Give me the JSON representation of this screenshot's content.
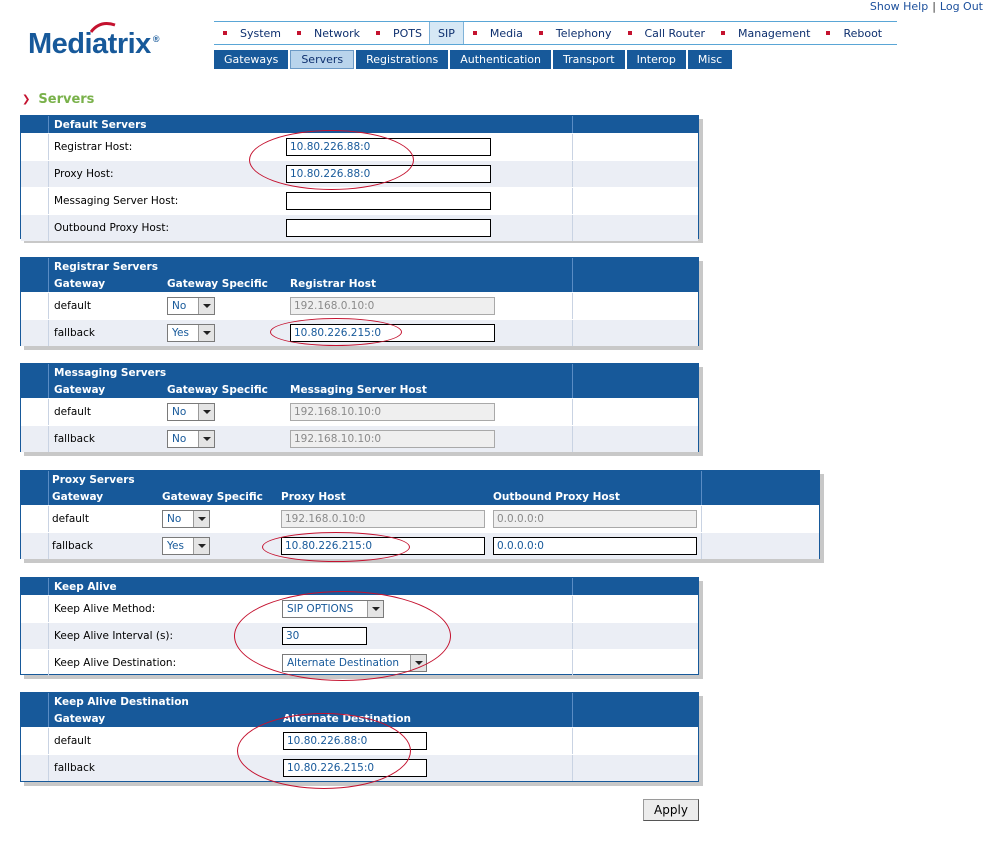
{
  "header": {
    "show_help": "Show Help",
    "separator": "|",
    "log_out": "Log Out",
    "logo": "Mediatrix",
    "logo_reg": "®"
  },
  "main_nav": [
    "System",
    "Network",
    "POTS",
    "SIP",
    "Media",
    "Telephony",
    "Call Router",
    "Management",
    "Reboot"
  ],
  "main_nav_active": "SIP",
  "sub_nav": [
    "Gateways",
    "Servers",
    "Registrations",
    "Authentication",
    "Transport",
    "Interop",
    "Misc"
  ],
  "sub_nav_active": "Servers",
  "page_title": "Servers",
  "default_servers": {
    "title": "Default Servers",
    "rows": [
      {
        "label": "Registrar Host:",
        "value": "10.80.226.88:0"
      },
      {
        "label": "Proxy Host:",
        "value": "10.80.226.88:0"
      },
      {
        "label": "Messaging Server Host:",
        "value": ""
      },
      {
        "label": "Outbound Proxy Host:",
        "value": ""
      }
    ]
  },
  "registrar_servers": {
    "title": "Registrar Servers",
    "col_gateway": "Gateway",
    "col_specific": "Gateway Specific",
    "col_host": "Registrar Host",
    "rows": [
      {
        "gateway": "default",
        "specific": "No",
        "host": "192.168.0.10:0"
      },
      {
        "gateway": "fallback",
        "specific": "Yes",
        "host": "10.80.226.215:0"
      }
    ]
  },
  "messaging_servers": {
    "title": "Messaging Servers",
    "col_gateway": "Gateway",
    "col_specific": "Gateway Specific",
    "col_host": "Messaging Server Host",
    "rows": [
      {
        "gateway": "default",
        "specific": "No",
        "host": "192.168.10.10:0"
      },
      {
        "gateway": "fallback",
        "specific": "No",
        "host": "192.168.10.10:0"
      }
    ]
  },
  "proxy_servers": {
    "title": "Proxy Servers",
    "col_gateway": "Gateway",
    "col_specific": "Gateway Specific",
    "col_host": "Proxy Host",
    "col_outbound": "Outbound Proxy Host",
    "rows": [
      {
        "gateway": "default",
        "specific": "No",
        "host": "192.168.0.10:0",
        "outbound": "0.0.0.0:0"
      },
      {
        "gateway": "fallback",
        "specific": "Yes",
        "host": "10.80.226.215:0",
        "outbound": "0.0.0.0:0"
      }
    ]
  },
  "keep_alive": {
    "title": "Keep Alive",
    "method_label": "Keep Alive Method:",
    "method_value": "SIP OPTIONS",
    "interval_label": "Keep Alive Interval (s):",
    "interval_value": "30",
    "destination_label": "Keep Alive Destination:",
    "destination_value": "Alternate Destination"
  },
  "keep_alive_destination": {
    "title": "Keep Alive Destination",
    "col_gateway": "Gateway",
    "col_alt": "Alternate Destination",
    "rows": [
      {
        "gateway": "default",
        "value": "10.80.226.88:0"
      },
      {
        "gateway": "fallback",
        "value": "10.80.226.215:0"
      }
    ]
  },
  "apply_label": "Apply",
  "colors": {
    "brand_blue": "#17599a",
    "accent_red": "#c4122f",
    "title_green": "#79b14a"
  }
}
